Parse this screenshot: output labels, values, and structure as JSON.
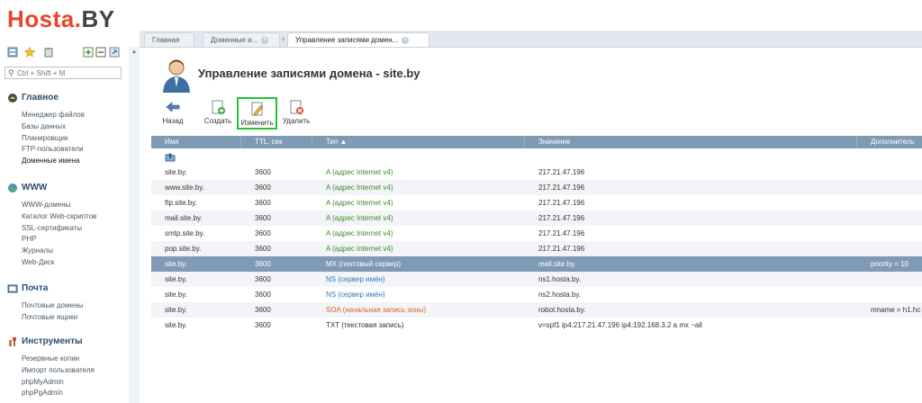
{
  "logo": {
    "main": "Hosta.",
    "suffix": "BY"
  },
  "sidebar": {
    "search_placeholder": "Ctrl + Shift + M",
    "groups": [
      {
        "title": "Главное",
        "items": [
          "Менеджер файлов",
          "Базы данных",
          "Планировщик",
          "FTP-пользователи",
          "Доменные имена"
        ]
      },
      {
        "title": "WWW",
        "items": [
          "WWW-домены",
          "Каталог Web-скриптов",
          "SSL-сертификаты",
          "PHP",
          "Журналы",
          "Web-Диск"
        ]
      },
      {
        "title": "Почта",
        "items": [
          "Почтовые домены",
          "Почтовые ящики"
        ]
      },
      {
        "title": "Инструменты",
        "items": [
          "Резервные копии",
          "Импорт пользователя",
          "phpMyAdmin",
          "phpPgAdmin"
        ]
      }
    ]
  },
  "tabs": [
    "Главная",
    "Доменные и...",
    "Управление записями домен..."
  ],
  "page": {
    "title": "Управление записями домена - site.by",
    "actions": {
      "back": "Назад",
      "create": "Создать",
      "edit": "Изменить",
      "delete": "Удалить"
    }
  },
  "grid": {
    "columns": [
      "Имя",
      "TTL, сек",
      "Тип ▲",
      "Значение",
      "Дополнитель"
    ],
    "rows": [
      {
        "name": "site.by.",
        "ttl": "3600",
        "type": "A (адрес Internet v4)",
        "value": "217.21.47.196",
        "extra": "",
        "style": "green"
      },
      {
        "name": "www.site.by.",
        "ttl": "3600",
        "type": "A (адрес Internet v4)",
        "value": "217.21.47.196",
        "extra": "",
        "style": "green"
      },
      {
        "name": "ftp.site.by.",
        "ttl": "3600",
        "type": "A (адрес Internet v4)",
        "value": "217.21.47.196",
        "extra": "",
        "style": "green"
      },
      {
        "name": "mail.site.by.",
        "ttl": "3600",
        "type": "A (адрес Internet v4)",
        "value": "217.21.47.196",
        "extra": "",
        "style": "green"
      },
      {
        "name": "smtp.site.by.",
        "ttl": "3600",
        "type": "A (адрес Internet v4)",
        "value": "217.21.47.196",
        "extra": "",
        "style": "green"
      },
      {
        "name": "pop.site.by.",
        "ttl": "3600",
        "type": "A (адрес Internet v4)",
        "value": "217.21.47.196",
        "extra": "",
        "style": "green"
      },
      {
        "name": "site.by.",
        "ttl": "3600",
        "type": "MX (почтовый сервер)",
        "value": "mail.site.by.",
        "extra": "priority = 10",
        "style": "selected"
      },
      {
        "name": "site.by.",
        "ttl": "3600",
        "type": "NS (сервер имён)",
        "value": "ns1.hosta.by.",
        "extra": "",
        "style": "blue"
      },
      {
        "name": "site.by.",
        "ttl": "3600",
        "type": "NS (сервер имён)",
        "value": "ns2.hosta.by.",
        "extra": "",
        "style": "blue"
      },
      {
        "name": "site.by.",
        "ttl": "3600",
        "type": "SOA (начальная запись зоны)",
        "value": "robot.hosta.by.",
        "extra": "mname = h1.hc",
        "style": "orange"
      },
      {
        "name": "site.by.",
        "ttl": "3600",
        "type": "TXT (текстовая запись)",
        "value": "v=spf1 ip4:217.21.47.196 ip4:192.168.3.2 a mx ~all",
        "extra": "",
        "style": "plain"
      }
    ]
  },
  "colors": {
    "accent": "#e8462c",
    "header": "#7f9ab5",
    "highlight": "#22c531"
  }
}
